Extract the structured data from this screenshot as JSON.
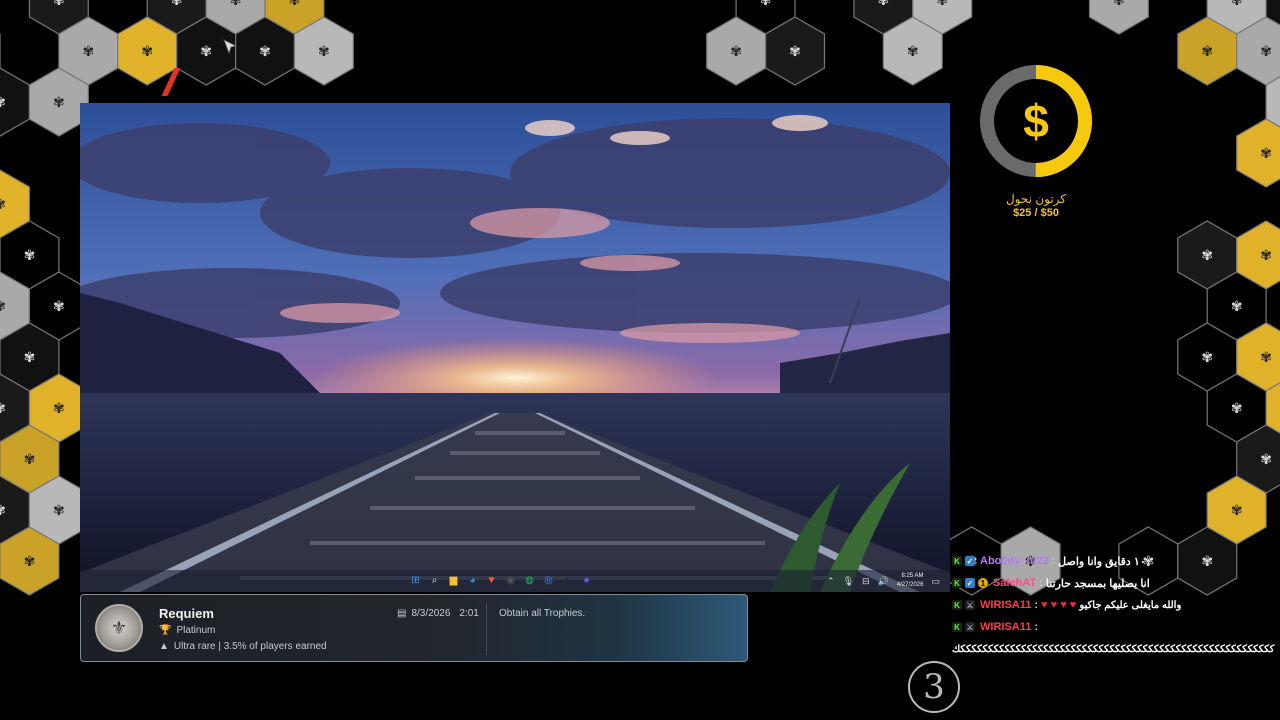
{
  "trophy": {
    "title": "Requiem",
    "grade": "Platinum",
    "rarity": "Ultra rare | 3.5% of players earned",
    "date": "8/3/2026",
    "time": "2:01",
    "description": "Obtain all Trophies."
  },
  "donation_goal": {
    "name": "كرتون نحول",
    "amount": "$25 / $50",
    "symbol": "$",
    "progress": 0.5,
    "accent": "#f6c90e"
  },
  "taskbar": {
    "time": "8:25 AM",
    "date": "4/27/2026",
    "apps": [
      "windows-start-icon",
      "search-icon",
      "file-explorer-icon",
      "edge-icon",
      "brave-icon",
      "obs-icon",
      "spotify-icon",
      "chrome-icon",
      "steam-icon",
      "discord-icon"
    ]
  },
  "chat": {
    "messages": [
      {
        "user": "Abo0dy_m22",
        "user_color": "#b37bf3",
        "text": "١٠ دقايق وانا واصل",
        "badges": [
          "kick",
          "verified"
        ]
      },
      {
        "user": "SalehAT",
        "user_color": "#ff4a8a",
        "text": "انا يصليها بمسجد حارتنا",
        "badges": [
          "kick",
          "verified",
          "sub-1"
        ]
      },
      {
        "user": "WIRISA11",
        "user_color": "#ff3b4e",
        "text": "والله مايغلى عليكم جاكيو",
        "hearts": 4,
        "badges": [
          "kick",
          "sword"
        ]
      },
      {
        "user": "WIRISA11",
        "user_color": "#ff3b4e",
        "text": "♥",
        "badges": [
          "kick",
          "sword"
        ]
      }
    ],
    "spam_line": "كككككككككككككككككككككككككككككككككككككككككككككككككككككككككك",
    "sub_badge_text": "1"
  },
  "watermark_number": "3"
}
